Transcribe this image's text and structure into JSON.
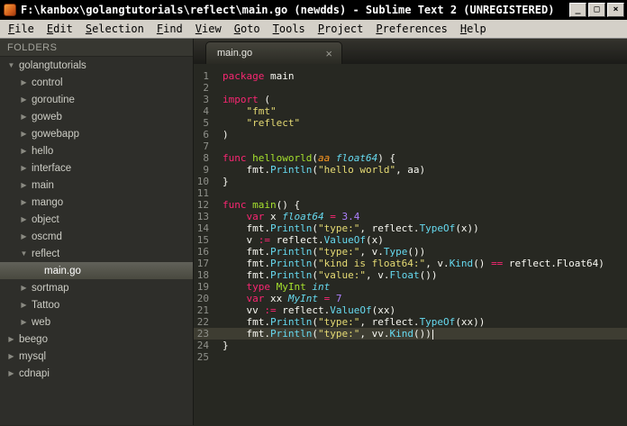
{
  "window": {
    "title": "F:\\kanbox\\golangtutorials\\reflect\\main.go (newdds) - Sublime Text 2 (UNREGISTERED)",
    "controls": {
      "minimize": "_",
      "maximize": "□",
      "close": "×"
    }
  },
  "menu": {
    "items": [
      "File",
      "Edit",
      "Selection",
      "Find",
      "View",
      "Goto",
      "Tools",
      "Project",
      "Preferences",
      "Help"
    ]
  },
  "sidebar": {
    "header": "FOLDERS",
    "tree": [
      {
        "label": "golangtutorials",
        "type": "folder",
        "level": 0,
        "expanded": true,
        "selected": false
      },
      {
        "label": "control",
        "type": "folder",
        "level": 1,
        "expanded": false,
        "selected": false
      },
      {
        "label": "goroutine",
        "type": "folder",
        "level": 1,
        "expanded": false,
        "selected": false
      },
      {
        "label": "goweb",
        "type": "folder",
        "level": 1,
        "expanded": false,
        "selected": false
      },
      {
        "label": "gowebapp",
        "type": "folder",
        "level": 1,
        "expanded": false,
        "selected": false
      },
      {
        "label": "hello",
        "type": "folder",
        "level": 1,
        "expanded": false,
        "selected": false
      },
      {
        "label": "interface",
        "type": "folder",
        "level": 1,
        "expanded": false,
        "selected": false
      },
      {
        "label": "main",
        "type": "folder",
        "level": 1,
        "expanded": false,
        "selected": false
      },
      {
        "label": "mango",
        "type": "folder",
        "level": 1,
        "expanded": false,
        "selected": false
      },
      {
        "label": "object",
        "type": "folder",
        "level": 1,
        "expanded": false,
        "selected": false
      },
      {
        "label": "oscmd",
        "type": "folder",
        "level": 1,
        "expanded": false,
        "selected": false
      },
      {
        "label": "reflect",
        "type": "folder",
        "level": 1,
        "expanded": true,
        "selected": false
      },
      {
        "label": "main.go",
        "type": "file",
        "level": 2,
        "expanded": false,
        "selected": true
      },
      {
        "label": "sortmap",
        "type": "folder",
        "level": 1,
        "expanded": false,
        "selected": false
      },
      {
        "label": "Tattoo",
        "type": "folder",
        "level": 1,
        "expanded": false,
        "selected": false
      },
      {
        "label": "web",
        "type": "folder",
        "level": 1,
        "expanded": false,
        "selected": false
      },
      {
        "label": "beego",
        "type": "folder",
        "level": 0,
        "expanded": false,
        "selected": false
      },
      {
        "label": "mysql",
        "type": "folder",
        "level": 0,
        "expanded": false,
        "selected": false
      },
      {
        "label": "cdnapi",
        "type": "folder",
        "level": 0,
        "expanded": false,
        "selected": false
      }
    ]
  },
  "editor": {
    "tab": {
      "label": "main.go",
      "close": "×"
    },
    "lines": [
      {
        "num": 1,
        "tokens": [
          [
            "kw",
            "package"
          ],
          [
            "pl",
            " main"
          ]
        ]
      },
      {
        "num": 2,
        "tokens": []
      },
      {
        "num": 3,
        "tokens": [
          [
            "kw",
            "import"
          ],
          [
            "pl",
            " ("
          ]
        ]
      },
      {
        "num": 4,
        "tokens": [
          [
            "pl",
            "    "
          ],
          [
            "str",
            "\"fmt\""
          ]
        ]
      },
      {
        "num": 5,
        "tokens": [
          [
            "pl",
            "    "
          ],
          [
            "str",
            "\"reflect\""
          ]
        ]
      },
      {
        "num": 6,
        "tokens": [
          [
            "pl",
            ")"
          ]
        ]
      },
      {
        "num": 7,
        "tokens": []
      },
      {
        "num": 8,
        "tokens": [
          [
            "kw",
            "func"
          ],
          [
            "fn",
            " helloworld"
          ],
          [
            "pl",
            "("
          ],
          [
            "param",
            "aa"
          ],
          [
            "typ",
            " float64"
          ],
          [
            "pl",
            ") {"
          ]
        ]
      },
      {
        "num": 9,
        "tokens": [
          [
            "pl",
            "    fmt."
          ],
          [
            "call",
            "Println"
          ],
          [
            "pl",
            "("
          ],
          [
            "str",
            "\"hello world\""
          ],
          [
            "pl",
            ", aa)"
          ]
        ]
      },
      {
        "num": 10,
        "tokens": [
          [
            "pl",
            "}"
          ]
        ]
      },
      {
        "num": 11,
        "tokens": []
      },
      {
        "num": 12,
        "tokens": [
          [
            "kw",
            "func"
          ],
          [
            "fn",
            " main"
          ],
          [
            "pl",
            "() {"
          ]
        ]
      },
      {
        "num": 13,
        "tokens": [
          [
            "pl",
            "    "
          ],
          [
            "kw",
            "var"
          ],
          [
            "pl",
            " x "
          ],
          [
            "typ",
            "float64"
          ],
          [
            "kw",
            " = "
          ],
          [
            "num",
            "3.4"
          ]
        ]
      },
      {
        "num": 14,
        "tokens": [
          [
            "pl",
            "    fmt."
          ],
          [
            "call",
            "Println"
          ],
          [
            "pl",
            "("
          ],
          [
            "str",
            "\"type:\""
          ],
          [
            "pl",
            ", reflect."
          ],
          [
            "call",
            "TypeOf"
          ],
          [
            "pl",
            "(x))"
          ]
        ]
      },
      {
        "num": 15,
        "tokens": [
          [
            "pl",
            "    v "
          ],
          [
            "kw",
            ":="
          ],
          [
            "pl",
            " reflect."
          ],
          [
            "call",
            "ValueOf"
          ],
          [
            "pl",
            "(x)"
          ]
        ]
      },
      {
        "num": 16,
        "tokens": [
          [
            "pl",
            "    fmt."
          ],
          [
            "call",
            "Println"
          ],
          [
            "pl",
            "("
          ],
          [
            "str",
            "\"type:\""
          ],
          [
            "pl",
            ", v."
          ],
          [
            "call",
            "Type"
          ],
          [
            "pl",
            "())"
          ]
        ]
      },
      {
        "num": 17,
        "tokens": [
          [
            "pl",
            "    fmt."
          ],
          [
            "call",
            "Println"
          ],
          [
            "pl",
            "("
          ],
          [
            "str",
            "\"kind is float64:\""
          ],
          [
            "pl",
            ", v."
          ],
          [
            "call",
            "Kind"
          ],
          [
            "pl",
            "() "
          ],
          [
            "kw",
            "=="
          ],
          [
            "pl",
            " reflect.Float64)"
          ]
        ]
      },
      {
        "num": 18,
        "tokens": [
          [
            "pl",
            "    fmt."
          ],
          [
            "call",
            "Println"
          ],
          [
            "pl",
            "("
          ],
          [
            "str",
            "\"value:\""
          ],
          [
            "pl",
            ", v."
          ],
          [
            "call",
            "Float"
          ],
          [
            "pl",
            "())"
          ]
        ]
      },
      {
        "num": 19,
        "tokens": [
          [
            "pl",
            "    "
          ],
          [
            "kw",
            "type"
          ],
          [
            "fn",
            " MyInt"
          ],
          [
            "typ",
            " int"
          ]
        ]
      },
      {
        "num": 20,
        "tokens": [
          [
            "pl",
            "    "
          ],
          [
            "kw",
            "var"
          ],
          [
            "pl",
            " xx "
          ],
          [
            "typ",
            "MyInt"
          ],
          [
            "kw",
            " = "
          ],
          [
            "num",
            "7"
          ]
        ]
      },
      {
        "num": 21,
        "tokens": [
          [
            "pl",
            "    vv "
          ],
          [
            "kw",
            ":="
          ],
          [
            "pl",
            " reflect."
          ],
          [
            "call",
            "ValueOf"
          ],
          [
            "pl",
            "(xx)"
          ]
        ]
      },
      {
        "num": 22,
        "tokens": [
          [
            "pl",
            "    fmt."
          ],
          [
            "call",
            "Println"
          ],
          [
            "pl",
            "("
          ],
          [
            "str",
            "\"type:\""
          ],
          [
            "pl",
            ", reflect."
          ],
          [
            "call",
            "TypeOf"
          ],
          [
            "pl",
            "(xx))"
          ]
        ]
      },
      {
        "num": 23,
        "tokens": [
          [
            "pl",
            "    fmt."
          ],
          [
            "call",
            "Println"
          ],
          [
            "pl",
            "("
          ],
          [
            "str",
            "\"type:\""
          ],
          [
            "pl",
            ", vv."
          ],
          [
            "call",
            "Kind"
          ],
          [
            "pl",
            "())"
          ]
        ],
        "current": true,
        "cursor": true
      },
      {
        "num": 24,
        "tokens": [
          [
            "pl",
            "}"
          ]
        ]
      },
      {
        "num": 25,
        "tokens": []
      }
    ]
  },
  "colors": {
    "titlebar_bg": "#000000",
    "menubar_bg": "#d4d0c8",
    "sidebar_bg": "#2e2e2a",
    "editor_bg": "#272822",
    "current_line": "#3e3d32",
    "keyword": "#f92672",
    "string": "#e6db74",
    "function_decl": "#a6e22e",
    "function_call": "#66d9ef",
    "type": "#66d9ef",
    "number": "#ae81ff",
    "text": "#f8f8f2",
    "line_number": "#8f908a"
  }
}
